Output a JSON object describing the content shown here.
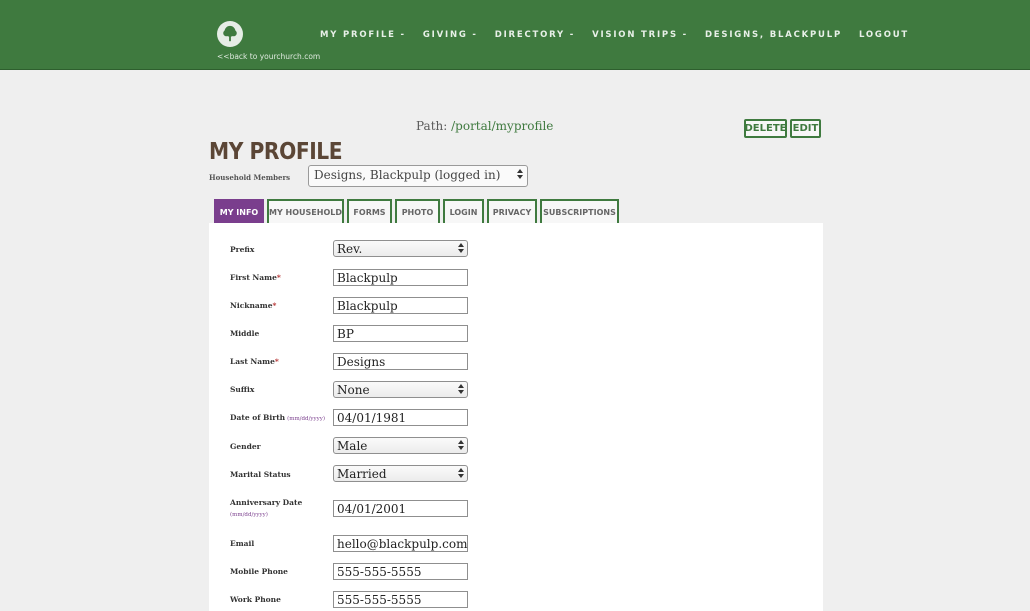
{
  "header": {
    "back_link": "<<back to yourchurch.com",
    "logo_icon": "tree-icon",
    "nav": [
      "MY PROFILE -",
      "GIVING -",
      "DIRECTORY -",
      "VISION TRIPS -",
      "DESIGNS, BLACKPULP",
      "LOGOUT"
    ]
  },
  "path": {
    "label": "Path:",
    "value": "/portal/myprofile"
  },
  "actions": {
    "delete": "DELETE",
    "edit": "EDIT"
  },
  "page": {
    "title": "MY PROFILE",
    "household_label": "Household Members",
    "household_value": "Designs, Blackpulp (logged in)"
  },
  "tabs": [
    "MY INFO",
    "MY HOUSEHOLD",
    "FORMS",
    "PHOTO",
    "LOGIN",
    "PRIVACY",
    "SUBSCRIPTIONS"
  ],
  "form": {
    "date_hint": "(mm/dd/yyyy)",
    "required_mark": "*",
    "fields": [
      {
        "label": "Prefix",
        "value": "Rev."
      },
      {
        "label": "First Name",
        "value": "Blackpulp"
      },
      {
        "label": "Nickname",
        "value": "Blackpulp"
      },
      {
        "label": "Middle",
        "value": "BP"
      },
      {
        "label": "Last Name",
        "value": "Designs"
      },
      {
        "label": "Suffix",
        "value": "None"
      },
      {
        "label": "Date of Birth",
        "value": "04/01/1981"
      },
      {
        "label": "Gender",
        "value": "Male"
      },
      {
        "label": "Marital Status",
        "value": "Married"
      },
      {
        "label": "Anniversary Date",
        "value": "04/01/2001"
      },
      {
        "label": "Email",
        "value": "hello@blackpulp.com"
      },
      {
        "label": "Mobile Phone",
        "value": "555-555-5555"
      },
      {
        "label": "Work Phone",
        "value": "555-555-5555"
      }
    ]
  },
  "colors": {
    "header_green": "#3f7a3f",
    "tab_active_purple": "#7a3e8d",
    "title_brown": "#5b4636",
    "required_red": "#b53030"
  }
}
